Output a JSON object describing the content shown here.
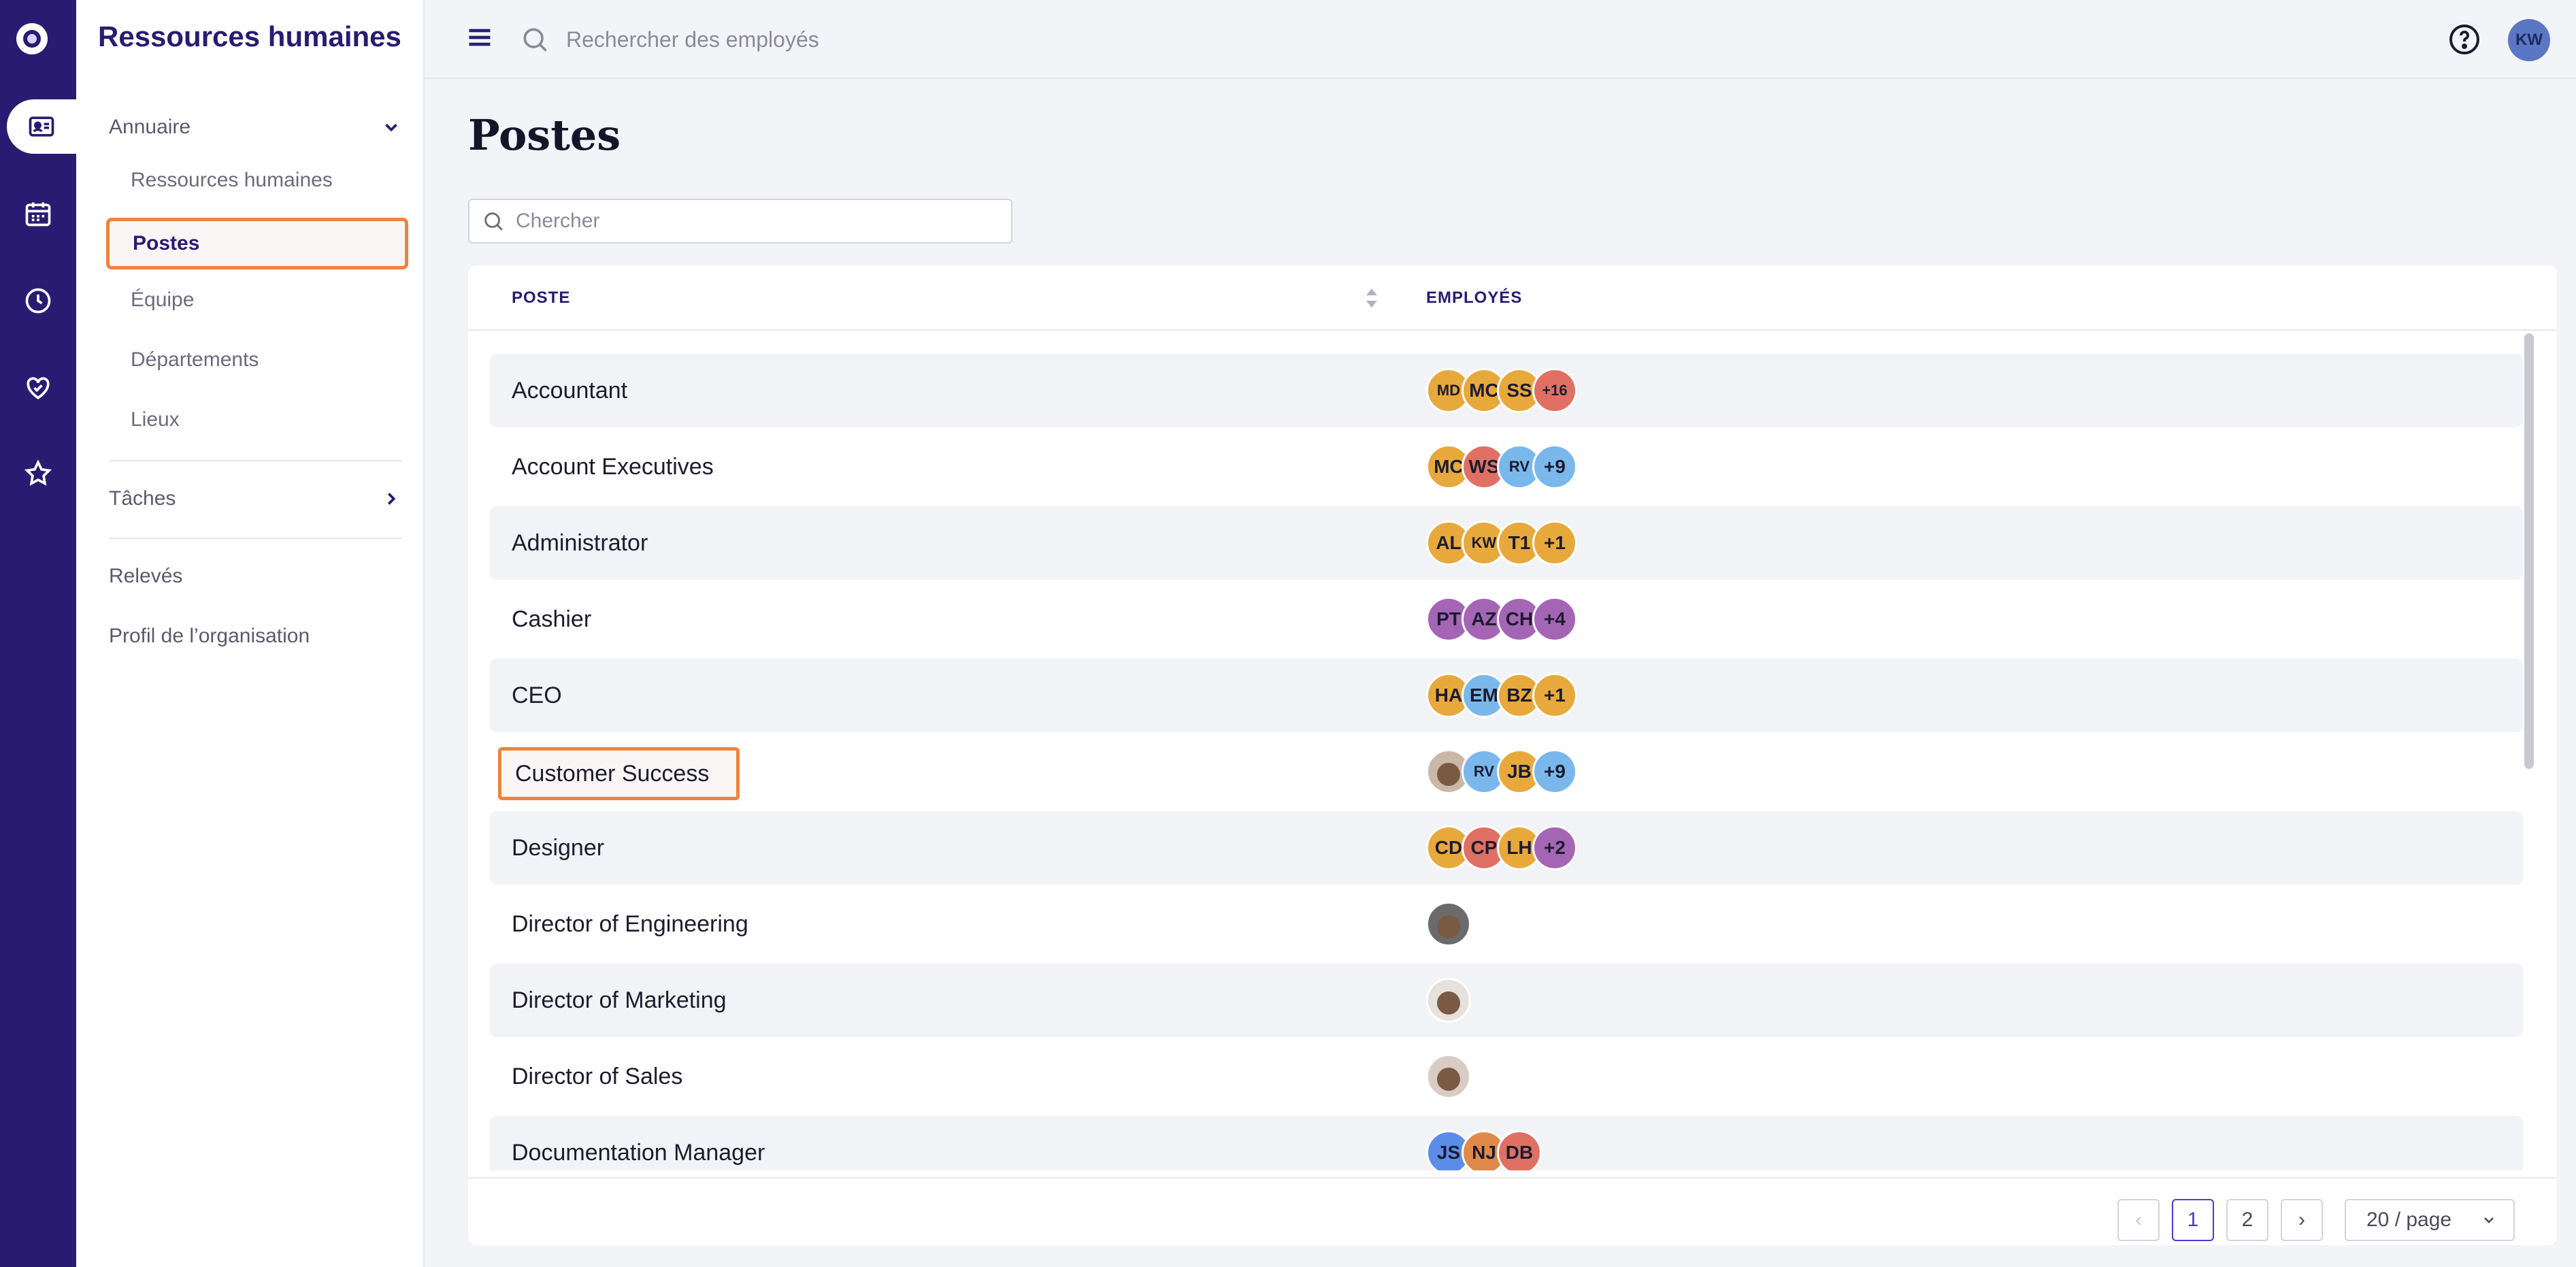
{
  "rail": {
    "items": [
      {
        "icon": "org-logo-icon"
      },
      {
        "icon": "id-card-icon",
        "active": true
      },
      {
        "icon": "calendar-icon"
      },
      {
        "icon": "clock-icon"
      },
      {
        "icon": "heart-hand-icon"
      },
      {
        "icon": "star-icon"
      }
    ]
  },
  "sidebar": {
    "brand": "Ressources humaines",
    "annuaire": "Annuaire",
    "items": [
      "Ressources humaines",
      "Postes",
      "Équipe",
      "Départements",
      "Lieux"
    ],
    "taches": "Tâches",
    "releves": "Relevés",
    "profil": "Profil de l’organisation"
  },
  "topbar": {
    "search_placeholder": "Rechercher des employés",
    "user_initials": "KW"
  },
  "main": {
    "title": "Postes",
    "filter_placeholder": "Chercher",
    "columns": {
      "poste": "POSTE",
      "employes": "EMPLOYÉS"
    }
  },
  "rows": [
    {
      "label": "Accountant",
      "avatars": [
        {
          "t": "MD",
          "c": "#e8a93c",
          "s": true
        },
        {
          "t": "MC",
          "c": "#e8a93c"
        },
        {
          "t": "SS",
          "c": "#e8a93c"
        },
        {
          "t": "+16",
          "c": "#e07064",
          "s": true
        }
      ]
    },
    {
      "label": "Account Executives",
      "avatars": [
        {
          "t": "MC",
          "c": "#e8a93c"
        },
        {
          "t": "WS",
          "c": "#e07064"
        },
        {
          "t": "RV",
          "c": "#7ab8ec",
          "s": true
        },
        {
          "t": "+9",
          "c": "#7ab8ec"
        }
      ]
    },
    {
      "label": "Administrator",
      "avatars": [
        {
          "t": "AL",
          "c": "#e8a93c"
        },
        {
          "t": "KW",
          "c": "#e8a93c",
          "s": true
        },
        {
          "t": "T1",
          "c": "#e8a93c"
        },
        {
          "t": "+1",
          "c": "#e8a93c"
        }
      ]
    },
    {
      "label": "Cashier",
      "avatars": [
        {
          "t": "PT",
          "c": "#a565b5"
        },
        {
          "t": "AZ",
          "c": "#a565b5"
        },
        {
          "t": "CH",
          "c": "#a565b5"
        },
        {
          "t": "+4",
          "c": "#a565b5"
        }
      ]
    },
    {
      "label": "CEO",
      "avatars": [
        {
          "t": "HA",
          "c": "#e8a93c"
        },
        {
          "t": "EM",
          "c": "#7ab8ec"
        },
        {
          "t": "BZ",
          "c": "#e8a93c"
        },
        {
          "t": "+1",
          "c": "#e8a93c"
        }
      ]
    },
    {
      "label": "Customer Success",
      "highlight": true,
      "avatars": [
        {
          "t": "",
          "c": "#c9b8a8",
          "photo": true
        },
        {
          "t": "RV",
          "c": "#7ab8ec",
          "s": true
        },
        {
          "t": "JB",
          "c": "#e8a93c"
        },
        {
          "t": "+9",
          "c": "#7ab8ec"
        }
      ]
    },
    {
      "label": "Designer",
      "avatars": [
        {
          "t": "CD",
          "c": "#e8a93c"
        },
        {
          "t": "CP",
          "c": "#e07064"
        },
        {
          "t": "LH",
          "c": "#e8a93c"
        },
        {
          "t": "+2",
          "c": "#a565b5"
        }
      ]
    },
    {
      "label": "Director of Engineering",
      "avatars": [
        {
          "t": "",
          "c": "#6b6b6b",
          "photo": true
        }
      ]
    },
    {
      "label": "Director of Marketing",
      "avatars": [
        {
          "t": "",
          "c": "#e6e1dc",
          "photo": true
        }
      ]
    },
    {
      "label": "Director of Sales",
      "avatars": [
        {
          "t": "",
          "c": "#d8ccc4",
          "photo": true
        }
      ]
    },
    {
      "label": "Documentation Manager",
      "avatars": [
        {
          "t": "JS",
          "c": "#5b8de8"
        },
        {
          "t": "NJ",
          "c": "#e08a4a"
        },
        {
          "t": "DB",
          "c": "#e07064"
        }
      ]
    }
  ],
  "pagination": {
    "prev": "‹",
    "pages": [
      "1",
      "2"
    ],
    "current": "1",
    "next": "›",
    "page_size": "20 / page"
  }
}
